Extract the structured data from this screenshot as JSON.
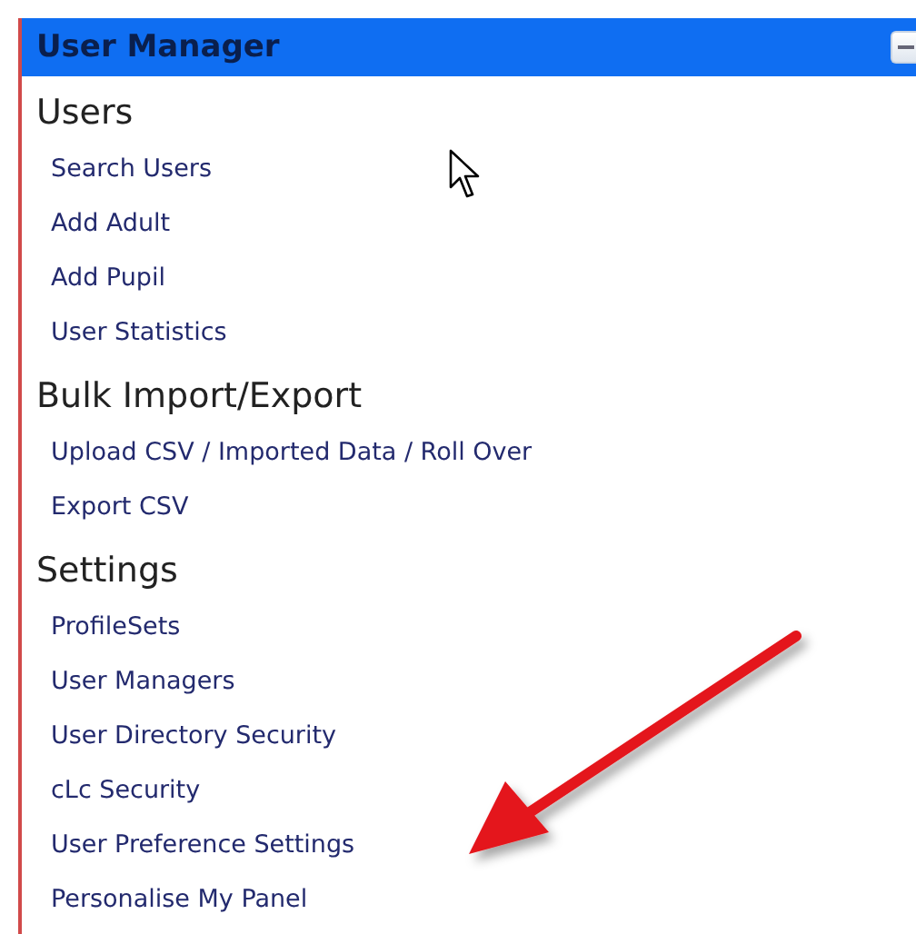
{
  "panel": {
    "title": "User Manager",
    "sections": [
      {
        "heading": "Users",
        "links": [
          "Search Users",
          "Add Adult",
          "Add Pupil",
          "User Statistics"
        ]
      },
      {
        "heading": "Bulk Import/Export",
        "links": [
          "Upload CSV / Imported Data / Roll Over",
          "Export CSV"
        ]
      },
      {
        "heading": "Settings",
        "links": [
          "ProfileSets",
          "User Managers",
          "User Directory Security",
          "cLc Security",
          "User Preference Settings",
          "Personalise My Panel"
        ]
      }
    ]
  }
}
